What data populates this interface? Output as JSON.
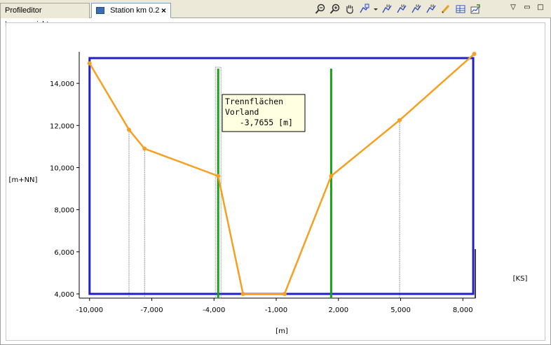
{
  "tabs": [
    {
      "label": "Profileditor Layeransicht"
    },
    {
      "label": "Station km 0.2",
      "close": "×"
    }
  ],
  "toolbar": [
    {
      "name": "zoom-out-icon"
    },
    {
      "name": "zoom-in-icon"
    },
    {
      "name": "pan-hand-icon"
    },
    {
      "name": "edit-profile-dropdown-icon"
    },
    {
      "name": "dropdown-arrow-icon"
    },
    {
      "name": "move-point-icon"
    },
    {
      "name": "insert-point-icon"
    },
    {
      "name": "delete-point-icon"
    },
    {
      "name": "select-point-icon"
    },
    {
      "name": "pencil-icon"
    },
    {
      "name": "table-icon"
    },
    {
      "name": "export-chart-icon"
    }
  ],
  "view_controls": {
    "menu": "▽",
    "minimize": "▭",
    "maximize": "□"
  },
  "chart_data": {
    "type": "line",
    "ylabel": "[m+NN]",
    "xlabel": "[m]",
    "right_label": "[KS]",
    "xlim": [
      -10500,
      8600
    ],
    "ylim": [
      3800,
      15500
    ],
    "x_ticks": [
      -10000,
      -7000,
      -4000,
      -1000,
      2000,
      5000,
      8000
    ],
    "x_tick_labels": [
      "-10,000",
      "-7,000",
      "-4,000",
      "-1,000",
      "2,000",
      "5,000",
      "8,000"
    ],
    "y_ticks": [
      4000,
      6000,
      8000,
      10000,
      12000,
      14000
    ],
    "y_tick_labels": [
      "4,000",
      "6,000",
      "8,000",
      "10,000",
      "12,000",
      "14,000"
    ],
    "profile": {
      "color": "#f5a020",
      "points": [
        [
          -10000,
          14950
        ],
        [
          -8100,
          11800
        ],
        [
          -7350,
          10900
        ],
        [
          -3800,
          9600
        ],
        [
          -2600,
          4000
        ],
        [
          -600,
          4000
        ],
        [
          1650,
          9600
        ],
        [
          4950,
          12250
        ],
        [
          8550,
          15400
        ]
      ]
    },
    "drop_lines_x": [
      -8100,
      -7350,
      -3800,
      4950
    ],
    "bounds": {
      "color": "#2020c8",
      "x_left": -10000,
      "x_right": 8500,
      "y_top": 15200,
      "y_bottom": 4000
    },
    "trennflaechen": {
      "color": "#1aa01a",
      "x": [
        -3800,
        1650
      ],
      "y_top": 14700
    },
    "tooltip": {
      "lines": [
        "Trennflächen",
        "Vorland",
        "   -3,7655 [m]"
      ]
    }
  }
}
